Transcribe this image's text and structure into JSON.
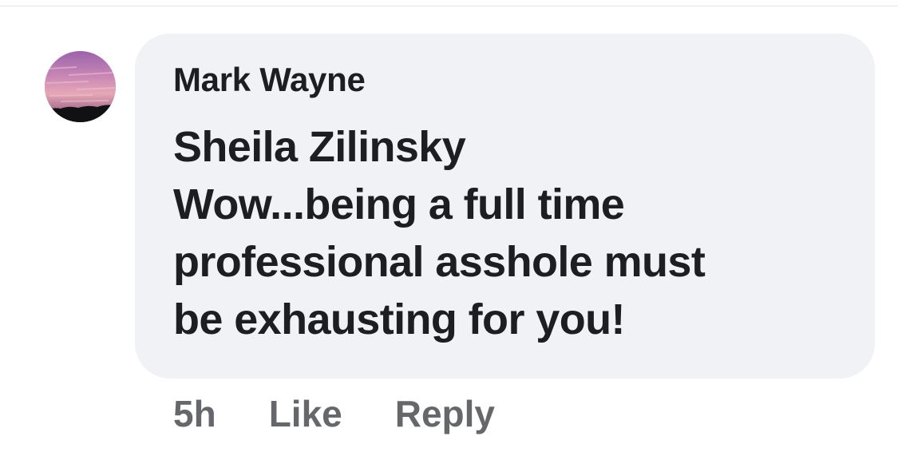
{
  "comment": {
    "author": "Mark Wayne",
    "mention": "Sheila Zilinsky",
    "text_lines": [
      "Wow...being a full time",
      "professional asshole must",
      "be exhausting for you!"
    ],
    "time": "5h",
    "like_label": "Like",
    "reply_label": "Reply",
    "avatar_icon": "user-avatar-sunset"
  },
  "colors": {
    "bubble_bg": "#f0f2f5",
    "text": "#1c1e21",
    "meta": "#65676b"
  }
}
